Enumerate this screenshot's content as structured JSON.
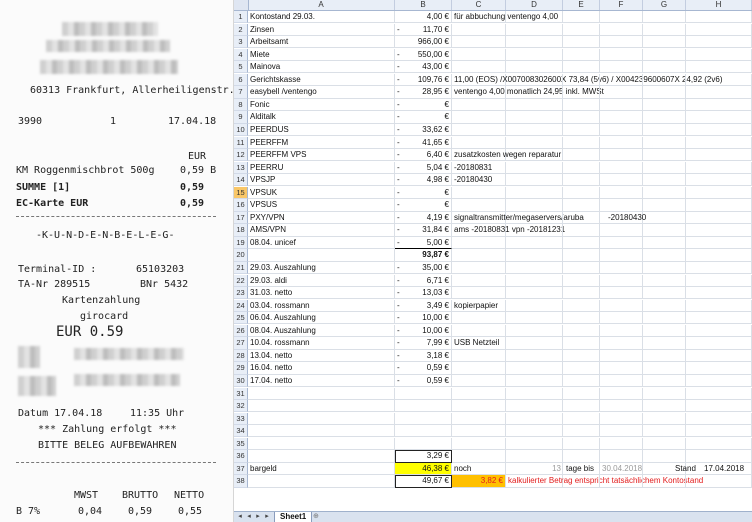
{
  "receipt": {
    "address": "60313 Frankfurt, Allerheiligenstr. 7",
    "store_no": "3990",
    "register_no": "1",
    "date": "17.04.18",
    "currency_header": "EUR",
    "item_name": "KM Roggenmischbrot 500g",
    "item_price": "0,59 B",
    "sum_label": "SUMME [1]",
    "sum_value": "0,59",
    "payment_label": "EC-Karte EUR",
    "payment_value": "0,59",
    "kundenbeleg": "-K-U-N-D-E-N-B-E-L-E-G-",
    "terminal_label": "Terminal-ID :",
    "terminal_value": "65103203",
    "ta_label": "TA-Nr 289515",
    "bnr_label": "BNr 5432",
    "kartenzahlung": "Kartenzahlung",
    "girocard": "girocard",
    "amount": "EUR 0.59",
    "datum_line": "Datum 17.04.18",
    "time": "11:35 Uhr",
    "zahlung": "*** Zahlung erfolgt ***",
    "aufbewahren": "BITTE BELEG AUFBEWAHREN",
    "tax_headers": [
      "MWST",
      "BRUTTO",
      "NETTO"
    ],
    "tax_row": [
      "B 7%",
      "0,04",
      "0,59",
      "0,55"
    ]
  },
  "sheet": {
    "columns": [
      "A",
      "B",
      "C",
      "D",
      "E",
      "F",
      "G",
      "H"
    ],
    "rows": [
      {
        "n": "1",
        "a": "Kontostand 29.03.",
        "m": "",
        "b": "4,00 €",
        "c": "für abbuchung ventengo 4,00"
      },
      {
        "n": "2",
        "a": "Zinsen",
        "m": "-",
        "b": "11,70 €"
      },
      {
        "n": "3",
        "a": "Arbeitsamt",
        "m": "",
        "b": "966,00 €"
      },
      {
        "n": "4",
        "a": "Miete",
        "m": "-",
        "b": "550,00 €"
      },
      {
        "n": "5",
        "a": "Mainova",
        "m": "-",
        "b": "43,00 €"
      },
      {
        "n": "6",
        "a": "Gerichtskasse",
        "m": "-",
        "b": "109,76 €",
        "c": "11,00 (EOS) /X007008302600X 73,84 (5v6) / X004239600607X 24,92 (2v6)"
      },
      {
        "n": "7",
        "a": "easybell /ventengo",
        "m": "-",
        "b": "28,95 €",
        "c": "ventengo 4,00  monatlich 24,95 inkl. MWSt"
      },
      {
        "n": "8",
        "a": "Fonic",
        "m": "-",
        "b": "€"
      },
      {
        "n": "9",
        "a": "Alditalk",
        "m": "-",
        "b": "€"
      },
      {
        "n": "10",
        "a": "PEERDUS",
        "m": "-",
        "b": "33,62 €"
      },
      {
        "n": "11",
        "a": "PEERFFM",
        "m": "-",
        "b": "41,65 €"
      },
      {
        "n": "12",
        "a": "PEERFFM VPS",
        "m": "-",
        "b": "6,40 €",
        "c": "zusatzkosten wegen reparatur"
      },
      {
        "n": "13",
        "a": "PEERRU",
        "m": "-",
        "b": "5,04 €",
        "c": "-20180831"
      },
      {
        "n": "14",
        "a": "VPSJP",
        "m": "-",
        "b": "4,98 €",
        "c": "-20180430"
      },
      {
        "n": "15",
        "a": "VPSUK",
        "m": "-",
        "b": "€",
        "sel": true
      },
      {
        "n": "16",
        "a": "VPSUS",
        "m": "-",
        "b": "€"
      },
      {
        "n": "17",
        "a": "PXY/VPN",
        "m": "-",
        "b": "4,19 €",
        "c": "signaltransmitter/megaservers/aruba",
        "f": "-20180430"
      },
      {
        "n": "18",
        "a": "AMS/VPN",
        "m": "-",
        "b": "31,84 €",
        "c": "ams -20180831 vpn -20181231"
      },
      {
        "n": "19",
        "a": "08.04. unicef",
        "m": "-",
        "b": "5,00 €",
        "ul": true
      },
      {
        "n": "20",
        "a": "",
        "m": "",
        "b": "93,87 €",
        "bold": true
      },
      {
        "n": "21",
        "a": "29.03. Auszahlung",
        "m": "-",
        "b": "35,00 €"
      },
      {
        "n": "22",
        "a": "29.03. aldi",
        "m": "-",
        "b": "6,71 €"
      },
      {
        "n": "23",
        "a": "31.03. netto",
        "m": "-",
        "b": "13,03 €"
      },
      {
        "n": "24",
        "a": "03.04. rossmann",
        "m": "-",
        "b": "3,49 €",
        "c": "kopierpapier"
      },
      {
        "n": "25",
        "a": "06.04. Auszahlung",
        "m": "-",
        "b": "10,00 €"
      },
      {
        "n": "26",
        "a": "08.04. Auszahlung",
        "m": "-",
        "b": "10,00 €"
      },
      {
        "n": "27",
        "a": "10.04. rossmann",
        "m": "-",
        "b": "7,99 €",
        "c": "USB Netzteil"
      },
      {
        "n": "28",
        "a": "13.04. netto",
        "m": "-",
        "b": "3,18 €"
      },
      {
        "n": "29",
        "a": "16.04. netto",
        "m": "-",
        "b": "0,59 €"
      },
      {
        "n": "30",
        "a": "17.04. netto",
        "m": "-",
        "b": "0,59 €"
      },
      {
        "n": "31"
      },
      {
        "n": "32"
      },
      {
        "n": "33"
      },
      {
        "n": "34"
      },
      {
        "n": "35"
      },
      {
        "n": "36",
        "a": "",
        "m": "",
        "b": "3,29 €",
        "boxed": true
      },
      {
        "n": "37",
        "a": "bargeld",
        "m": "",
        "b": "46,38 €",
        "c": "noch",
        "byellow": true,
        "e": "13",
        "e2": "tage bis",
        "f2": "30.04.2018",
        "g": "Stand",
        "h": "17.04.2018"
      },
      {
        "n": "38",
        "a": "",
        "m": "",
        "b": "49,67 €",
        "c38": "3,82 €",
        "d38": "kalkulierter Betrag entspricht tatsächlichem Kontostand",
        "boxed": true
      }
    ],
    "sheet_tab": "Sheet1",
    "colors": {
      "highlight": "#ffff00",
      "orange": "#ffc000",
      "alert": "#e21b1b",
      "header": "#e8eef7"
    }
  }
}
